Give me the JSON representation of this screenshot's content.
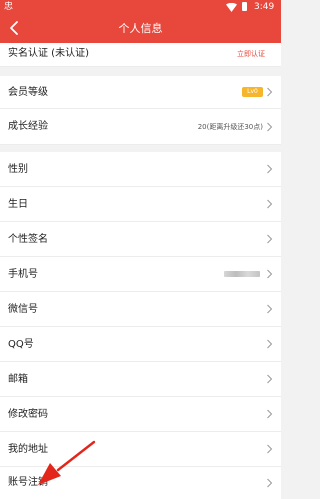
{
  "status_bar": {
    "app_glyph": "忠",
    "time": "3:49"
  },
  "header": {
    "title": "个人信息"
  },
  "realname": {
    "label": "实名认证 (未认证)",
    "action": "立即认证"
  },
  "member_level": {
    "label": "会员等级",
    "badge": "Lv0"
  },
  "growth": {
    "label": "成长经验",
    "value": "20(距离升级还30点)"
  },
  "profile_items": {
    "gender": "性别",
    "birthday": "生日",
    "signature": "个性签名",
    "phone": "手机号",
    "wechat": "微信号",
    "qq": "QQ号",
    "email": "邮箱",
    "change_password": "修改密码",
    "address": "我的地址",
    "cancel_account": "账号注销"
  },
  "colors": {
    "brand_red": "#e8473c",
    "level_badge": "#f6b52b",
    "annotation_arrow": "#e3261b"
  },
  "icons": {
    "back": "chevron-left-icon",
    "row_arrow": "chevron-right-icon",
    "wifi": "wifi-icon",
    "battery": "battery-icon"
  }
}
